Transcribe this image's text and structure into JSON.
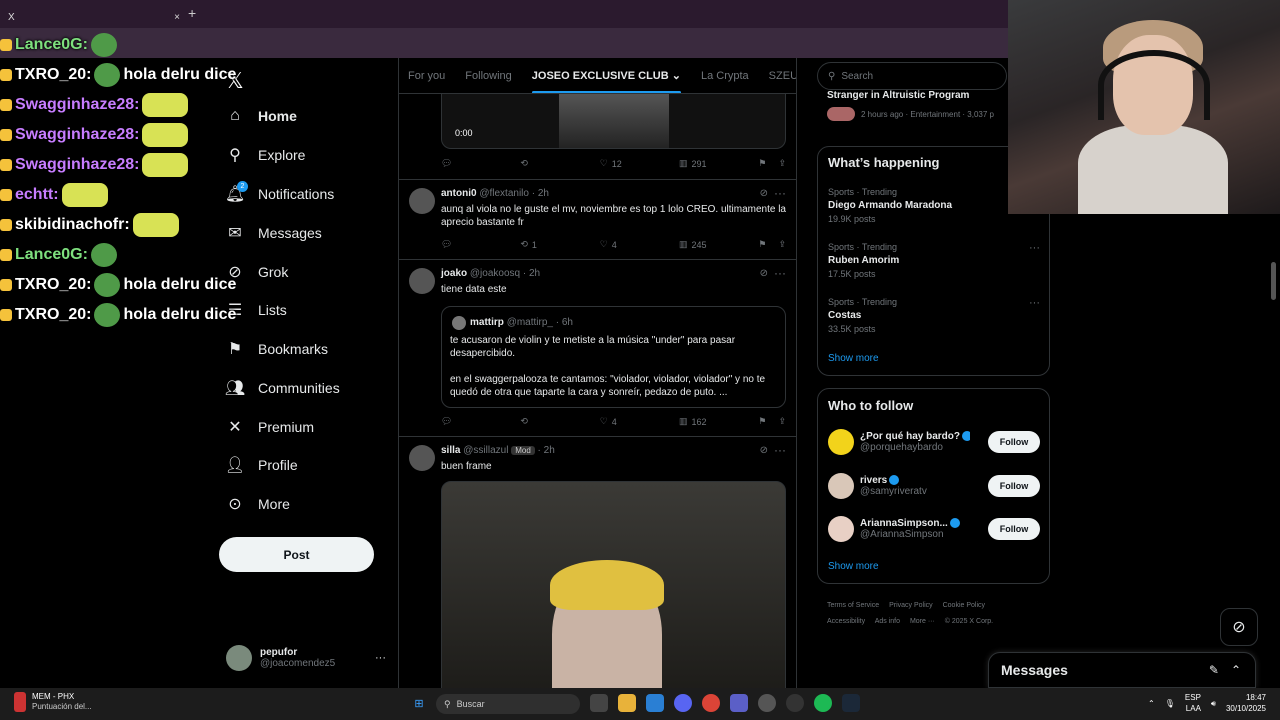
{
  "browser": {
    "tab_title": "X",
    "new_tab": "+",
    "close_tab": "×",
    "address_home_label": "Home"
  },
  "stream_chat": [
    {
      "user": "Lance0G:",
      "msg": "",
      "color": "green"
    },
    {
      "user": "TXRO_20:",
      "msg": "hola delru dice",
      "color": "white"
    },
    {
      "user": "Swagginhaze28:",
      "msg": "",
      "color": "purple"
    },
    {
      "user": "Swagginhaze28:",
      "msg": "",
      "color": "purple"
    },
    {
      "user": "Swagginhaze28:",
      "msg": "",
      "color": "purple"
    },
    {
      "user": "echtt:",
      "msg": "",
      "color": "purple"
    },
    {
      "user": "skibidinachofr:",
      "msg": "",
      "color": "white"
    },
    {
      "user": "Lance0G:",
      "msg": "",
      "color": "green"
    },
    {
      "user": "TXRO_20:",
      "msg": "hola delru dice",
      "color": "white"
    },
    {
      "user": "TXRO_20:",
      "msg": "hola delru dice",
      "color": "white"
    }
  ],
  "nav": {
    "logo": "𝕏",
    "items": [
      {
        "label": "Home",
        "icon": "home-icon"
      },
      {
        "label": "Explore",
        "icon": "search-icon"
      },
      {
        "label": "Notifications",
        "icon": "bell-icon",
        "badge": "2"
      },
      {
        "label": "Messages",
        "icon": "envelope-icon"
      },
      {
        "label": "Grok",
        "icon": "grok-icon"
      },
      {
        "label": "Lists",
        "icon": "list-icon"
      },
      {
        "label": "Bookmarks",
        "icon": "bookmark-icon"
      },
      {
        "label": "Communities",
        "icon": "people-icon"
      },
      {
        "label": "Premium",
        "icon": "x-icon"
      },
      {
        "label": "Profile",
        "icon": "person-icon"
      },
      {
        "label": "More",
        "icon": "more-circle-icon"
      }
    ],
    "post_button": "Post",
    "account": {
      "name": "pepufor",
      "handle": "@joacomendez5"
    }
  },
  "feed": {
    "tabs": [
      "For you",
      "Following",
      "JOSEO EXCLUSIVE CLUB",
      "La Crypta",
      "SZEUS Pe"
    ],
    "selected_tab": "JOSEO EXCLUSIVE CLUB",
    "posts": [
      {
        "video_time": "0:00",
        "actions": {
          "reply": "",
          "repost": "",
          "like": "12",
          "views": "291"
        }
      },
      {
        "name": "antoni0",
        "handle": "@flextanilo",
        "time": "· 2h",
        "text": "aunq al viola no le guste el mv, noviembre es top 1 lolo CREO. ultimamente la aprecio bastante fr",
        "actions": {
          "reply": "",
          "repost": "1",
          "like": "4",
          "views": "245"
        }
      },
      {
        "name": "joako",
        "handle": "@joakoosq",
        "time": "· 2h",
        "text": "tiene data este",
        "quote": {
          "name": "mattirp",
          "handle": "@mattirp_",
          "time": "· 6h",
          "text1": "te acusaron de violin y te metiste a la música \"under\" para pasar desapercibido.",
          "text2": "en el swaggerpalooza te cantamos: \"violador, violador, violador\" y no te quedó de otra que taparte la cara y sonreír, pedazo de puto. ..."
        },
        "actions": {
          "reply": "",
          "repost": "",
          "like": "4",
          "views": "162"
        }
      },
      {
        "name": "silla",
        "handle": "@ssillazul",
        "badge": "Mod",
        "time": "· 2h",
        "text": "buen frame"
      }
    ]
  },
  "sidebar": {
    "search_placeholder": "Search",
    "top_event": {
      "title": "Stranger in Altruistic Program",
      "meta": "2 hours ago · Entertainment · 3,037 p"
    },
    "happening_title": "What’s happening",
    "trends": [
      {
        "meta": "Sports · Trending",
        "name": "Diego Armando Maradona",
        "count": "19.9K posts"
      },
      {
        "meta": "Sports · Trending",
        "name": "Ruben Amorim",
        "count": "17.5K posts"
      },
      {
        "meta": "Sports · Trending",
        "name": "Costas",
        "count": "33.5K posts"
      }
    ],
    "show_more": "Show more",
    "who_to_follow_title": "Who to follow",
    "follow": [
      {
        "name": "¿Por qué hay bardo?",
        "handle": "@porquehaybardo",
        "btn": "Follow",
        "avatar_color": "#f2d31b"
      },
      {
        "name": "rivers",
        "handle": "@samyriveratv",
        "btn": "Follow",
        "avatar_color": "#d9c7b8"
      },
      {
        "name": "AriannaSimpson...",
        "handle": "@AriannaSimpson",
        "btn": "Follow",
        "avatar_color": "#e8d0c5"
      }
    ],
    "show_more_2": "Show more",
    "footer": [
      "Terms of Service",
      "Privacy Policy",
      "Cookie Policy",
      "Accessibility",
      "Ads info",
      "More ···",
      "© 2025 X Corp."
    ]
  },
  "messages_dock": {
    "title": "Messages"
  },
  "taskbar": {
    "app_title": "MEM - PHX",
    "app_sub": "Puntuación del...",
    "search": "Buscar",
    "lang1": "ESP",
    "lang2": "LAA",
    "time": "18:47",
    "date": "30/10/2025"
  }
}
